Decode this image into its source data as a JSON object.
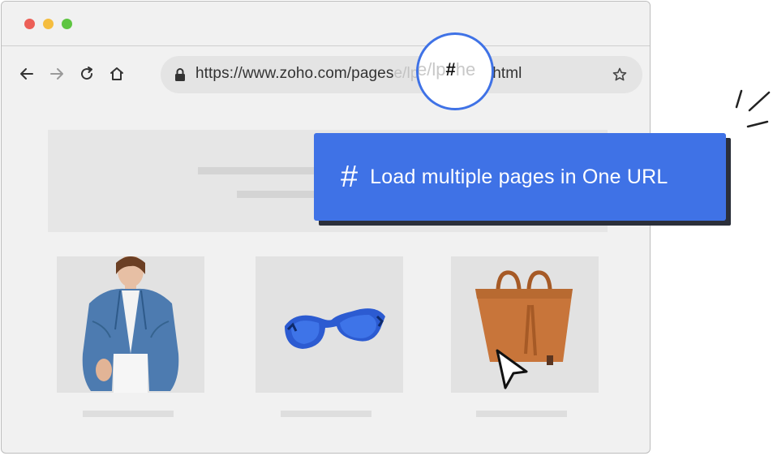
{
  "window": {
    "controls": [
      "close",
      "minimize",
      "maximize"
    ],
    "colors": {
      "close": "#ec5f57",
      "minimize": "#f5bd3f",
      "maximize": "#5ec541"
    }
  },
  "toolbar": {
    "back_icon": "arrow-left-icon",
    "forward_icon": "arrow-right-icon",
    "reload_icon": "reload-icon",
    "home_icon": "home-icon",
    "bookmark_icon": "star-icon"
  },
  "address_bar": {
    "url_start": "https://www.zoho.com/pages",
    "url_faded": "e/lp",
    "url_hash": "#",
    "url_faded_end": "he",
    "url_end": "atmap.html"
  },
  "magnifier": {
    "before": "e/lp",
    "hash": "#",
    "after": "he"
  },
  "callout": {
    "icon": "#",
    "text": "Load multiple pages in One URL",
    "accent": "#3f72e6"
  },
  "products": [
    {
      "name": "denim-jacket"
    },
    {
      "name": "sunglasses"
    },
    {
      "name": "handbag"
    }
  ]
}
